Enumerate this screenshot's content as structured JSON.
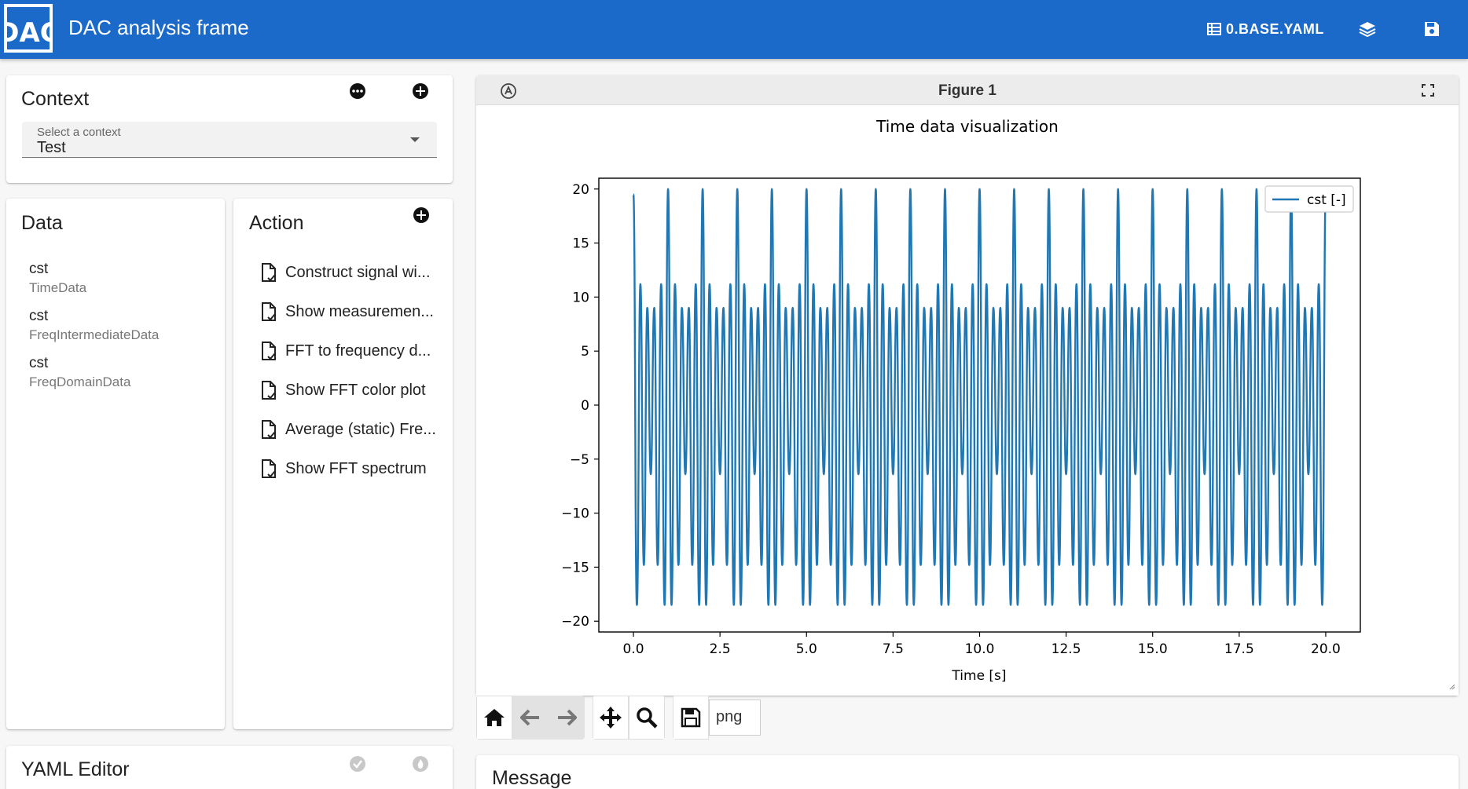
{
  "app": {
    "title": "DAC analysis frame",
    "logo_text": "DAC",
    "file_label": "0.BASE.YAML",
    "colors": {
      "appbar": "#1b6ac9",
      "series": "#1f77b4"
    }
  },
  "context": {
    "title": "Context",
    "select_label": "Select a context",
    "select_value": "Test"
  },
  "data_panel": {
    "title": "Data",
    "items": [
      {
        "name": "cst",
        "type": "TimeData"
      },
      {
        "name": "cst",
        "type": "FreqIntermediateData"
      },
      {
        "name": "cst",
        "type": "FreqDomainData"
      }
    ]
  },
  "action_panel": {
    "title": "Action",
    "items": [
      {
        "label": "Construct signal wi..."
      },
      {
        "label": "Show measuremen..."
      },
      {
        "label": "FFT to frequency d..."
      },
      {
        "label": "Show FFT color plot"
      },
      {
        "label": "Average (static) Fre..."
      },
      {
        "label": "Show FFT spectrum"
      }
    ]
  },
  "yaml_editor": {
    "title": "YAML Editor"
  },
  "figure": {
    "title": "Figure 1",
    "save_format": "png"
  },
  "message": {
    "title": "Message"
  },
  "chart_data": {
    "type": "line",
    "title": "Time data visualization",
    "xlabel": "Time [s]",
    "ylabel": "",
    "xlim": [
      -1,
      21
    ],
    "ylim": [
      -21,
      21
    ],
    "xticks": [
      0.0,
      2.5,
      5.0,
      7.5,
      10.0,
      12.5,
      15.0,
      17.5,
      20.0
    ],
    "xtick_labels": [
      "0.0",
      "2.5",
      "5.0",
      "7.5",
      "10.0",
      "12.5",
      "15.0",
      "17.5",
      "20.0"
    ],
    "yticks": [
      20,
      15,
      10,
      5,
      0,
      -5,
      -10,
      -15,
      -20
    ],
    "ytick_labels": [
      "20",
      "15",
      "10",
      "5",
      "0",
      "−5",
      "−10",
      "−15",
      "−20"
    ],
    "legend_position": "top-right",
    "grid": false,
    "series": [
      {
        "name": "cst [-]",
        "color": "#1f77b4",
        "x": [
          0.0,
          0.1,
          0.2,
          0.3,
          0.4,
          0.5,
          0.6,
          0.7,
          0.8,
          0.9,
          1.0
        ],
        "y": [
          19.5,
          -18.5,
          11.2,
          -14.8,
          9.0,
          -6.4,
          9.0,
          -14.8,
          11.2,
          -18.5,
          20.0
        ],
        "note_periodic": "pattern repeats every 1.0 s from 0.0 to 20.0"
      }
    ]
  }
}
